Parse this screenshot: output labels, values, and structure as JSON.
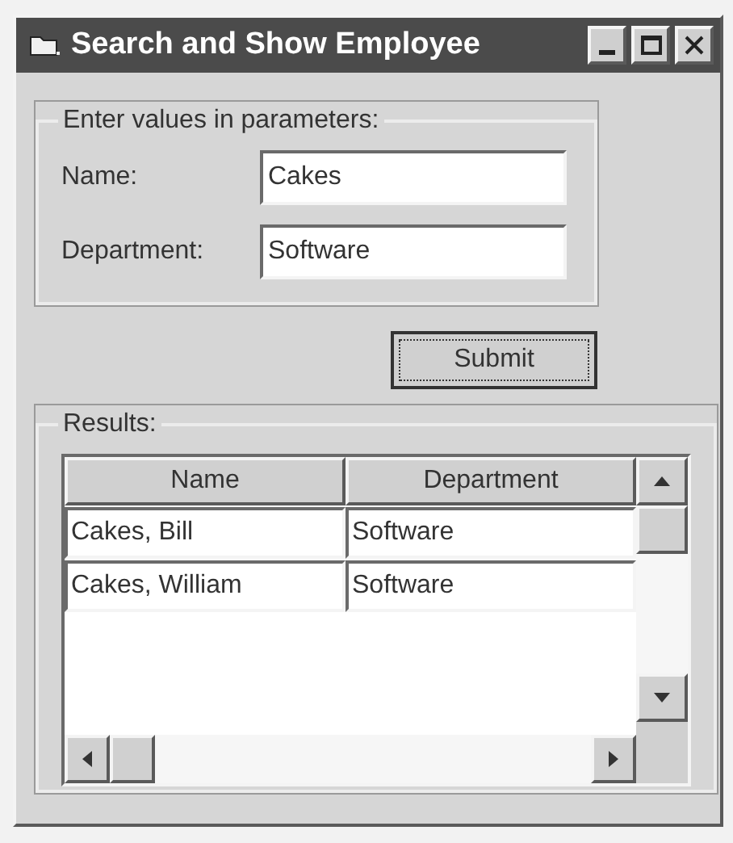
{
  "window": {
    "title": "Search and Show Employee"
  },
  "parameters": {
    "label": "Enter values in parameters:",
    "fields": [
      {
        "label": "Name:",
        "value": "Cakes"
      },
      {
        "label": "Department:",
        "value": "Software"
      }
    ]
  },
  "submit_button": "Submit",
  "results": {
    "label": "Results:",
    "columns": [
      "Name",
      "Department"
    ],
    "rows": [
      [
        "Cakes, Bill",
        "Software"
      ],
      [
        "Cakes, William",
        "Software"
      ]
    ]
  }
}
